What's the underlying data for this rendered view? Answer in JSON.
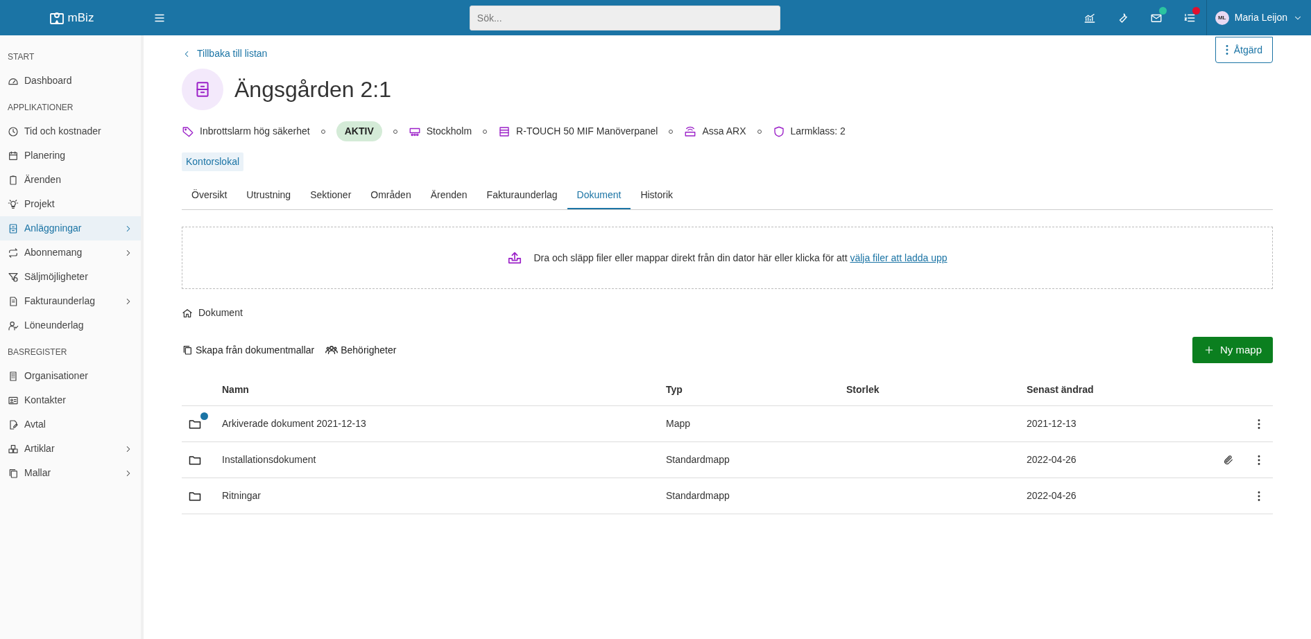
{
  "topbar": {
    "logo": "mBiz",
    "search": {
      "placeholder": "Sök..."
    },
    "notification_dots": [
      {
        "color": "#2bc4a0"
      },
      {
        "color": "#e0102e"
      }
    ],
    "user": {
      "initials": "ML",
      "name": "Maria Leijon"
    }
  },
  "sidebar": {
    "sections": [
      {
        "title": "START",
        "items": [
          {
            "label": "Dashboard",
            "selected": false,
            "submenu": false
          }
        ]
      },
      {
        "title": "APPLIKATIONER",
        "items": [
          {
            "label": "Tid och kostnader",
            "selected": false,
            "submenu": false
          },
          {
            "label": "Planering",
            "selected": false,
            "submenu": false
          },
          {
            "label": "Ärenden",
            "selected": false,
            "submenu": false
          },
          {
            "label": "Projekt",
            "selected": false,
            "submenu": false
          },
          {
            "label": "Anläggningar",
            "selected": true,
            "submenu": true
          },
          {
            "label": "Abonnemang",
            "selected": false,
            "submenu": true
          },
          {
            "label": "Säljmöjligheter",
            "selected": false,
            "submenu": false
          },
          {
            "label": "Fakturaunderlag",
            "selected": false,
            "submenu": true
          },
          {
            "label": "Löneunderlag",
            "selected": false,
            "submenu": false
          }
        ]
      },
      {
        "title": "BASREGISTER",
        "items": [
          {
            "label": "Organisationer",
            "selected": false,
            "submenu": false
          },
          {
            "label": "Kontakter",
            "selected": false,
            "submenu": false
          },
          {
            "label": "Avtal",
            "selected": false,
            "submenu": false
          },
          {
            "label": "Artiklar",
            "selected": false,
            "submenu": true
          },
          {
            "label": "Mallar",
            "selected": false,
            "submenu": true
          }
        ]
      }
    ]
  },
  "page": {
    "back": "Tillbaka till listan",
    "action": "Åtgärd",
    "title": "Ängsgården 2:1",
    "meta": [
      {
        "kind": "text",
        "label": "Inbrottslarm hög säkerhet"
      },
      {
        "kind": "status",
        "label": "AKTIV"
      },
      {
        "kind": "text",
        "label": "Stockholm"
      },
      {
        "kind": "text",
        "label": "R-TOUCH 50 MIF Manöverpanel"
      },
      {
        "kind": "text",
        "label": "Assa ARX"
      },
      {
        "kind": "text",
        "label": "Larmklass: 2"
      }
    ],
    "tags": [
      "Kontorslokal"
    ],
    "tabs": [
      {
        "label": "Översikt",
        "selected": false
      },
      {
        "label": "Utrustning",
        "selected": false
      },
      {
        "label": "Sektioner",
        "selected": false
      },
      {
        "label": "Områden",
        "selected": false
      },
      {
        "label": "Ärenden",
        "selected": false
      },
      {
        "label": "Fakturaunderlag",
        "selected": false
      },
      {
        "label": "Dokument",
        "selected": true
      },
      {
        "label": "Historik",
        "selected": false
      }
    ],
    "dropzone": {
      "text": "Dra och släpp filer eller mappar direkt från din dator här eller klicka för att",
      "link": "välja filer att ladda upp"
    },
    "breadcrumb": "Dokument",
    "toolbar": {
      "templates": "Skapa från dokumentmallar",
      "permissions": "Behörigheter",
      "new_folder": "Ny mapp"
    },
    "table": {
      "columns": [
        "Namn",
        "Typ",
        "Storlek",
        "Senast ändrad"
      ],
      "rows": [
        {
          "name": "Arkiverade dokument 2021-12-13",
          "type": "Mapp",
          "modified": "2021-12-13",
          "badge": true,
          "attachment": false
        },
        {
          "name": "Installationsdokument",
          "type": "Standardmapp",
          "modified": "2022-04-26",
          "badge": false,
          "attachment": true
        },
        {
          "name": "Ritningar",
          "type": "Standardmapp",
          "modified": "2022-04-26",
          "badge": false,
          "attachment": false
        }
      ]
    }
  }
}
